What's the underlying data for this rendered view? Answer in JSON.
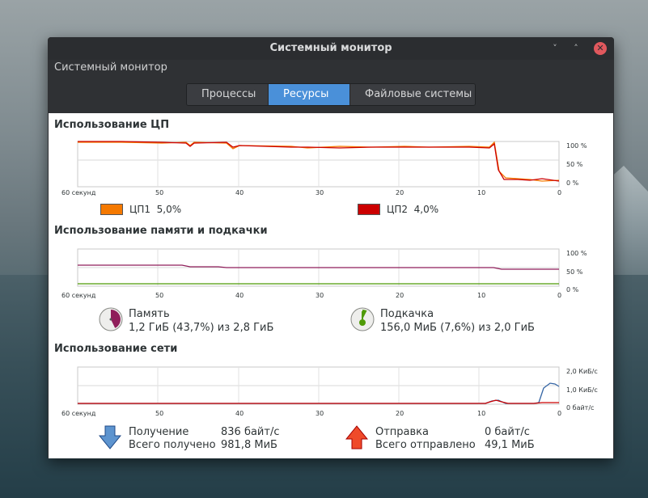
{
  "window": {
    "title": "Системный монитор",
    "subtitle": "Системный монитор",
    "close_glyph": "✕",
    "minimize_glyph": "˅",
    "maximize_glyph": "˄"
  },
  "tabs": [
    {
      "label": "Процессы",
      "active": false
    },
    {
      "label": "Ресурсы",
      "active": true
    },
    {
      "label": "Файловые системы",
      "active": false
    }
  ],
  "x_axis_ticks": [
    "60 секунд",
    "50",
    "40",
    "30",
    "20",
    "10",
    "0"
  ],
  "cpu": {
    "title": "Использование ЦП",
    "y_ticks": [
      "100 %",
      "50 %",
      "0 %"
    ],
    "cores": [
      {
        "label": "ЦП1",
        "value": "5,0%",
        "color": "#f57900"
      },
      {
        "label": "ЦП2",
        "value": "4,0%",
        "color": "#cc0000"
      }
    ]
  },
  "memory": {
    "title": "Использование памяти и подкачки",
    "y_ticks": [
      "100 %",
      "50 %",
      "0 %"
    ],
    "memory_label": "Память",
    "memory_value": "1,2 ГиБ (43,7%) из 2,8 ГиБ",
    "memory_color": "#8f1e5a",
    "swap_label": "Подкачка",
    "swap_value": "156,0 МиБ (7,6%) из 2,0 ГиБ",
    "swap_color": "#4e9a06"
  },
  "network": {
    "title": "Использование сети",
    "y_ticks": [
      "2,0 КиБ/с",
      "1,0 КиБ/с",
      "0 байт/с"
    ],
    "receive_label": "Получение",
    "receive_rate": "836 байт/с",
    "receive_total_label": "Всего получено",
    "receive_total": "981,8 МиБ",
    "receive_color": "#3465a4",
    "send_label": "Отправка",
    "send_rate": "0 байт/с",
    "send_total_label": "Всего отправлено",
    "send_total": "49,1 МиБ",
    "send_color": "#cc0000"
  }
}
